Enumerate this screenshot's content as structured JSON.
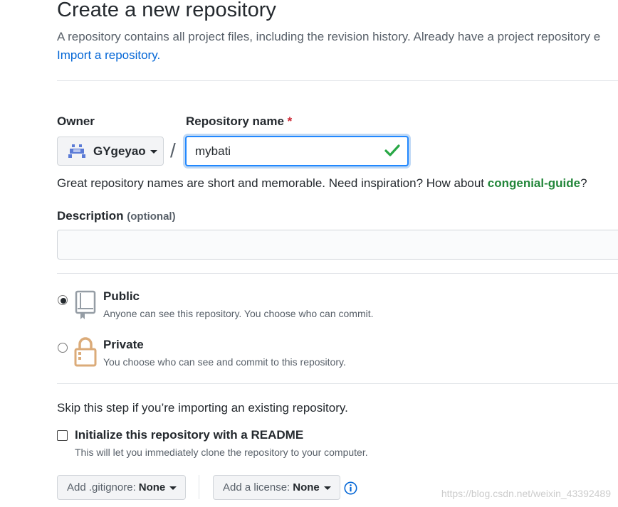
{
  "header": {
    "title": "Create a new repository",
    "intro": "A repository contains all project files, including the revision history. Already have a project repository e",
    "import_link": "Import a repository."
  },
  "owner": {
    "label": "Owner",
    "value": "GYgeyao"
  },
  "separator": "/",
  "repo_name": {
    "label": "Repository name",
    "required_mark": "*",
    "value": "mybati"
  },
  "hint": {
    "text": "Great repository names are short and memorable. Need inspiration? How about",
    "suggestion": "congenial-guide",
    "end": "?"
  },
  "description": {
    "label": "Description",
    "optional": "(optional)",
    "value": ""
  },
  "visibility": {
    "selected": "public",
    "public": {
      "title": "Public",
      "subtitle": "Anyone can see this repository. You choose who can commit."
    },
    "private": {
      "title": "Private",
      "subtitle": "You choose who can see and commit to this repository."
    }
  },
  "init": {
    "skip_text": "Skip this step if you’re importing an existing repository.",
    "readme_label": "Initialize this repository with a README",
    "readme_sub": "This will let you immediately clone the repository to your computer.",
    "readme_checked": false
  },
  "gitignore": {
    "label": "Add .gitignore:",
    "value": "None"
  },
  "license": {
    "label": "Add a license:",
    "value": "None"
  },
  "info_icon": "info-icon",
  "watermark": "https://blog.csdn.net/weixin_43392489",
  "colors": {
    "link": "#0366d6",
    "success": "#28a745",
    "suggestion": "#22863a",
    "required": "#cb2431",
    "focus": "#2188ff"
  }
}
